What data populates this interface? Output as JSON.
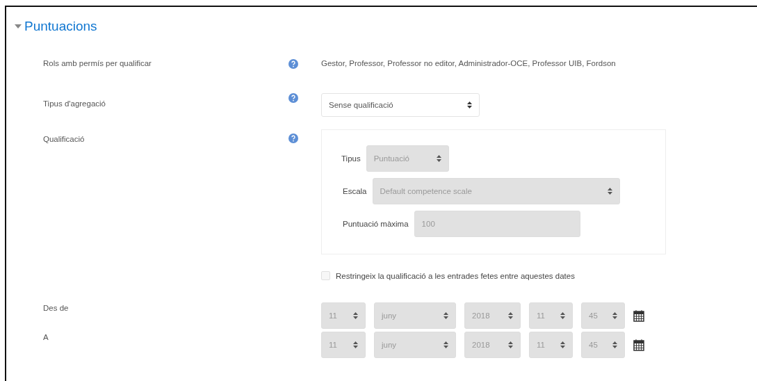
{
  "section": {
    "title": "Puntuacions",
    "expanded": true
  },
  "rows": [
    {
      "kind": "text",
      "label": "Rols amb permís per qualificar",
      "help": true,
      "value": "Gestor, Professor, Professor no editor, Administrador-OCE, Professor UIB, Fordson"
    },
    {
      "kind": "select",
      "label": "Tipus d'agregació",
      "help": true,
      "value": "Sense qualificació",
      "disabled": false
    },
    {
      "kind": "group",
      "label": "Qualificació",
      "help": true,
      "fields": [
        {
          "kind": "select",
          "label": "Tipus",
          "value": "Puntuació",
          "disabled": true
        },
        {
          "kind": "select",
          "label": "Escala",
          "value": "Default competence scale",
          "disabled": true
        },
        {
          "kind": "input",
          "label": "Puntuació màxima",
          "value": "100",
          "disabled": true
        }
      ]
    },
    {
      "kind": "checkbox",
      "text": "Restringeix la qualificació a les entrades fetes entre aquestes dates",
      "checked": false,
      "disabled": true
    },
    {
      "kind": "date",
      "label": "Des de",
      "fields": [
        {
          "value": "11",
          "disabled": true
        },
        {
          "value": "juny",
          "disabled": true
        },
        {
          "value": "2018",
          "disabled": true
        },
        {
          "value": "11",
          "disabled": true
        },
        {
          "value": "45",
          "disabled": true
        }
      ]
    },
    {
      "kind": "date",
      "label": "A",
      "fields": [
        {
          "value": "11",
          "disabled": true
        },
        {
          "value": "juny",
          "disabled": true
        },
        {
          "value": "2018",
          "disabled": true
        },
        {
          "value": "11",
          "disabled": true
        },
        {
          "value": "45",
          "disabled": true
        }
      ]
    }
  ]
}
